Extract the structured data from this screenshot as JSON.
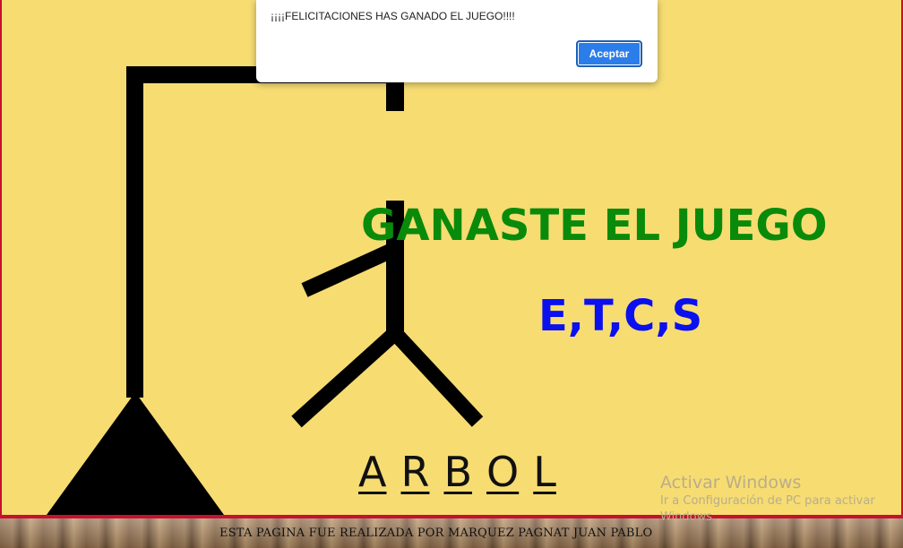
{
  "alert": {
    "message": "¡¡¡¡FELICITACIONES HAS GANADO EL JUEGO!!!!",
    "accept_label": "Aceptar"
  },
  "game": {
    "status": "GANASTE EL JUEGO",
    "used_letters": "E,T,C,S",
    "word_letters": [
      "A",
      "R",
      "B",
      "O",
      "L"
    ]
  },
  "footer": {
    "credit": "ESTA PAGINA FUE REALIZADA POR MARQUEZ PAGNAT JUAN PABLO"
  },
  "watermark": {
    "title": "Activar Windows",
    "subtitle_line1": "Ir a Configuración de PC para activar",
    "subtitle_line2": "Windows."
  },
  "colors": {
    "background": "#f7dc72",
    "status": "#0a8a0a",
    "used_letters": "#0a10ee",
    "button": "#2b7de9",
    "frame": "#c8102e"
  }
}
